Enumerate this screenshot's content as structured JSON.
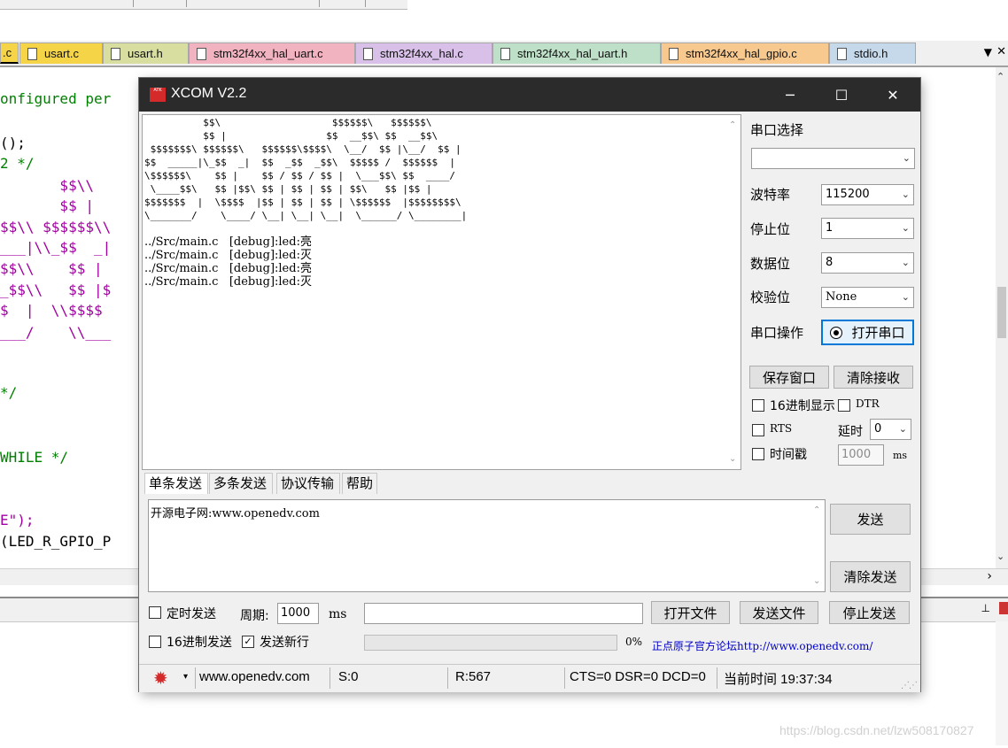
{
  "ide": {
    "tabs": [
      {
        "label": ".c",
        "color": "#f5d547"
      },
      {
        "label": "usart.c",
        "color": "#f5d547"
      },
      {
        "label": "usart.h",
        "color": "#d8dea0"
      },
      {
        "label": "stm32f4xx_hal_uart.c",
        "color": "#f2b3c1"
      },
      {
        "label": "stm32f4xx_hal.c",
        "color": "#d8c0e8"
      },
      {
        "label": "stm32f4xx_hal_uart.h",
        "color": "#bfe0c8"
      },
      {
        "label": "stm32f4xx_hal_gpio.c",
        "color": "#f7c98f"
      },
      {
        "label": "stdio.h",
        "color": "#c6d9ea"
      }
    ],
    "tab_menu_icon": "dropdown-arrow-icon",
    "code_lines": [
      {
        "text": "onfigured per",
        "style": "green"
      },
      {
        "text": "();",
        "style": "text"
      },
      {
        "text": "2 */",
        "style": "green"
      },
      {
        "text": "       $$\\\\",
        "style": "purple"
      },
      {
        "text": "       $$ |",
        "style": "purple"
      },
      {
        "text": "$$\\\\ $$$$$$\\\\",
        "style": "purple"
      },
      {
        "text": "___|\\\\_$$  _|",
        "style": "purple"
      },
      {
        "text": "$$\\\\    $$ |",
        "style": "purple"
      },
      {
        "text": "_$$\\\\   $$ |$",
        "style": "purple"
      },
      {
        "text": "$  |  \\\\$$$$",
        "style": "purple"
      },
      {
        "text": "___/    \\\\___",
        "style": "purple"
      },
      {
        "text": "*/",
        "style": "green"
      },
      {
        "text": "WHILE */",
        "style": "green"
      },
      {
        "text": "E\");",
        "style": "purple"
      },
      {
        "text": "(LED_R_GPIO_P",
        "style": "text"
      }
    ],
    "watermark": "https://blog.csdn.net/lzw508170827"
  },
  "xcom": {
    "title": "XCOM V2.2",
    "logo_text": "ATK",
    "window_controls": {
      "minimize": "─",
      "maximize": "☐",
      "close": "✕"
    },
    "receive": {
      "ascii_art": [
        "          $$\\                   $$$$$$\\   $$$$$$\\",
        "          $$ |                 $$  __$$\\ $$  __$$\\",
        " $$$$$$$\\ $$$$$$\\   $$$$$$\\$$$$\\  \\__/  $$ |\\__/  $$ |",
        "$$  _____|\\_$$  _|  $$  _$$  _$$\\  $$$$$ /  $$$$$$  |",
        "\\$$$$$$\\    $$ |    $$ / $$ / $$ |  \\___$$\\ $$  ____/",
        " \\____$$\\   $$ |$$\\ $$ | $$ | $$ | $$\\   $$ |$$ |",
        "$$$$$$$  |  \\$$$$  |$$ | $$ | $$ | \\$$$$$$  |$$$$$$$$\\",
        "\\_______/    \\____/ \\__| \\__| \\__|  \\______/ \\________|"
      ],
      "log_lines": [
        "../Src/main.c   [debug]:led:亮",
        "../Src/main.c   [debug]:led:灭",
        "../Src/main.c   [debug]:led:亮",
        "../Src/main.c   [debug]:led:灭"
      ]
    },
    "settings": {
      "port_label": "串口选择",
      "port_value": "",
      "baud_label": "波特率",
      "baud_value": "115200",
      "stopbits_label": "停止位",
      "stopbits_value": "1",
      "databits_label": "数据位",
      "databits_value": "8",
      "parity_label": "校验位",
      "parity_value": "None",
      "port_op_label": "串口操作",
      "open_port_button": "打开串口",
      "save_window_button": "保存窗口",
      "clear_receive_button": "清除接收",
      "hex_display_label": "16进制显示",
      "hex_display_checked": false,
      "dtr_label": "DTR",
      "dtr_checked": false,
      "rts_label": "RTS",
      "rts_checked": false,
      "delay_label": "延时",
      "delay_value": "0",
      "timestamp_label": "时间戳",
      "timestamp_checked": false,
      "timestamp_ms_value": "1000",
      "ms_unit": "ms"
    },
    "send_tabs": [
      "单条发送",
      "多条发送",
      "协议传输",
      "帮助"
    ],
    "send": {
      "text": "开源电子网:www.openedv.com",
      "send_button": "发送",
      "clear_send_button": "清除发送",
      "timed_send_label": "定时发送",
      "timed_send_checked": false,
      "period_label": "周期:",
      "period_value": "1000",
      "period_unit": "ms",
      "file_path_value": "",
      "open_file_button": "打开文件",
      "send_file_button": "发送文件",
      "stop_send_button": "停止发送",
      "hex_send_label": "16进制发送",
      "hex_send_checked": false,
      "newline_label": "发送新行",
      "newline_checked": true,
      "check_mark": "✓",
      "progress_percent": "0%",
      "progress_value": 0,
      "forum_link": "正点原子官方论坛http://www.openedv.com/"
    },
    "status": {
      "gear_icon": "gear-icon",
      "website": "www.openedv.com",
      "sent": "S:0",
      "received": "R:567",
      "lines": "CTS=0 DSR=0 DCD=0",
      "time": "当前时间 19:37:34"
    }
  }
}
